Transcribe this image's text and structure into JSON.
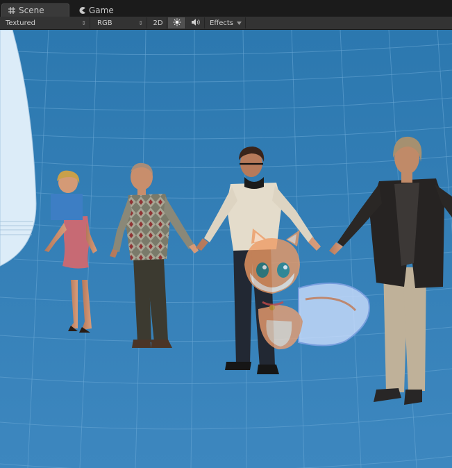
{
  "tabs": [
    {
      "label": "Scene",
      "icon": "grid-icon",
      "active": true
    },
    {
      "label": "Game",
      "icon": "pacman-icon",
      "active": false
    }
  ],
  "toolbar": {
    "shading_mode": "Textured",
    "render_mode": "RGB",
    "toggle_2d": "2D",
    "lighting_icon": "sun-icon",
    "audio_icon": "speaker-icon",
    "effects_label": "Effects",
    "effects_dropdown_icon": "triangle-down-icon",
    "dropdown_arrow": "⇕"
  },
  "colors": {
    "floor": "#3a84bb",
    "sky": "#2d79b0",
    "grid_line": "#66a8d8",
    "skybox_wall": "#dcecf8"
  },
  "scene": {
    "characters": [
      "woman-pink-dress",
      "old-man-argyle-sweater",
      "man-glasses-white-sweater",
      "man-black-blazer"
    ],
    "overlay": "fox-mascot-watermark",
    "redaction": "blue-censor-box"
  }
}
